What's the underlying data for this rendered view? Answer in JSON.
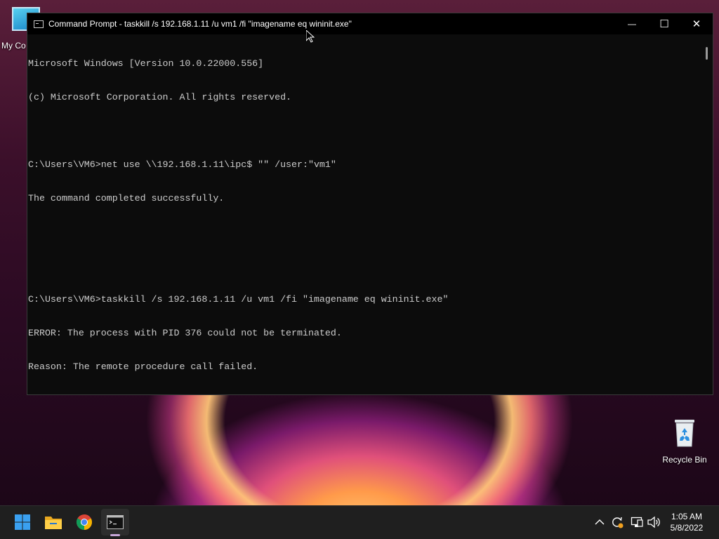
{
  "desktop": {
    "my_computer_label": "My Co",
    "recycle_bin_label": "Recycle Bin"
  },
  "window": {
    "title": "Command Prompt - taskkill  /s 192.168.1.11 /u vm1 /fi \"imagename eq wininit.exe\"",
    "minimize_glyph": "—",
    "maximize_glyph": "☐",
    "close_glyph": "✕",
    "console_lines": [
      "Microsoft Windows [Version 10.0.22000.556]",
      "(c) Microsoft Corporation. All rights reserved.",
      "",
      "C:\\Users\\VM6>net use \\\\192.168.1.11\\ipc$ \"\" /user:\"vm1\"",
      "The command completed successfully.",
      "",
      "",
      "C:\\Users\\VM6>taskkill /s 192.168.1.11 /u vm1 /fi \"imagename eq wininit.exe\"",
      "ERROR: The process with PID 376 could not be terminated.",
      "Reason: The remote procedure call failed."
    ]
  },
  "taskbar": {
    "items": [
      "start-icon",
      "file-explorer-icon",
      "chrome-icon",
      "command-prompt-icon"
    ],
    "tray_icons": [
      "chevron-up-icon",
      "sync-icon",
      "network-icon",
      "volume-icon"
    ],
    "time": "1:05 AM",
    "date": "5/8/2022"
  },
  "colors": {
    "console_bg": "#0c0c0c",
    "console_text": "#cccccc",
    "taskbar_bg": "#1f1f1f"
  }
}
